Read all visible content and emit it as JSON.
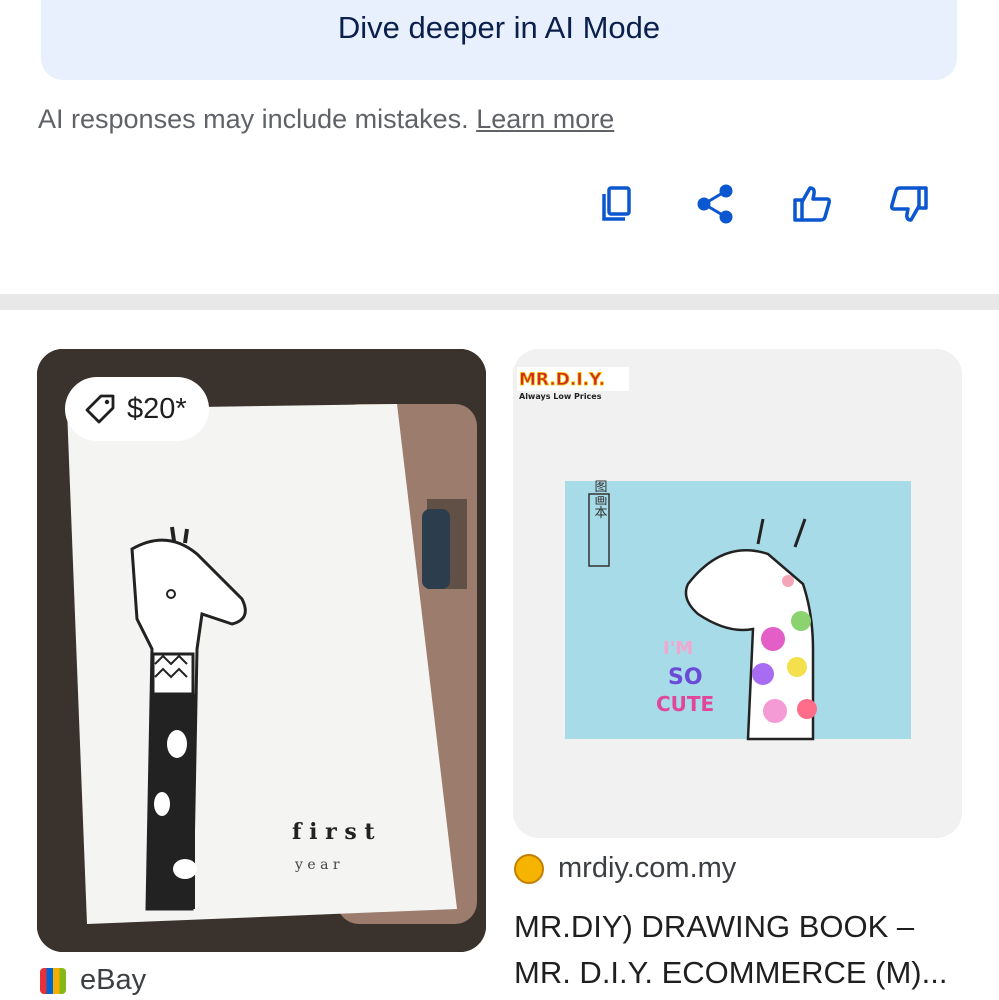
{
  "ai_mode": {
    "button_label": "Dive deeper in AI Mode"
  },
  "disclaimer": {
    "text": "AI responses may include mistakes. ",
    "link": "Learn more"
  },
  "colors": {
    "accent": "#0b57d0",
    "panel": "#e8f0fe",
    "divider": "#e8e8e8"
  },
  "actions": [
    "copy-icon",
    "share-icon",
    "thumbs-up-icon",
    "thumbs-down-icon"
  ],
  "results": [
    {
      "price": "$20*",
      "source": "eBay",
      "image_text": {
        "line1": "f i r s t",
        "line2": "y e a r"
      }
    },
    {
      "source": "mrdiy.com.my",
      "title": "MR.DIY) DRAWING BOOK – MR. D.I.Y. ECOMMERCE (M)...",
      "image_text": {
        "brand": "MR.D.I.Y.",
        "tagline": "Always Low Prices",
        "side_label": "图画本",
        "slogan1": "I'M",
        "slogan2": "SO",
        "slogan3": "CUTE"
      }
    }
  ]
}
